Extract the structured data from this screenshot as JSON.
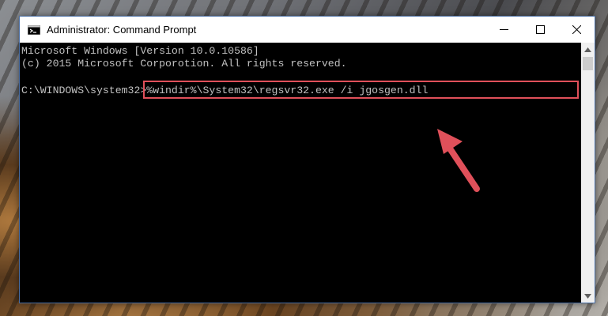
{
  "window": {
    "title": "Administrator: Command Prompt",
    "icon": "cmd-icon",
    "controls": [
      "minimize-icon",
      "maximize-icon",
      "close-icon"
    ]
  },
  "console": {
    "lines": [
      "Microsoft Windows [Version 10.0.10586]",
      "(c) 2015 Microsoft Corporotion. All rights reserved."
    ],
    "prompt": "C:\\WINDOWS\\system32>",
    "command": "%windir%\\System32\\regsvr32.exe /i jgosgen.dll"
  },
  "annotation": {
    "highlight_color": "#e0505a",
    "arrow_color": "#e0505a"
  },
  "colors": {
    "console_bg": "#000000",
    "console_text": "#c0c0c0",
    "titlebar_bg": "#ffffff",
    "window_border": "#4a6fa5"
  }
}
